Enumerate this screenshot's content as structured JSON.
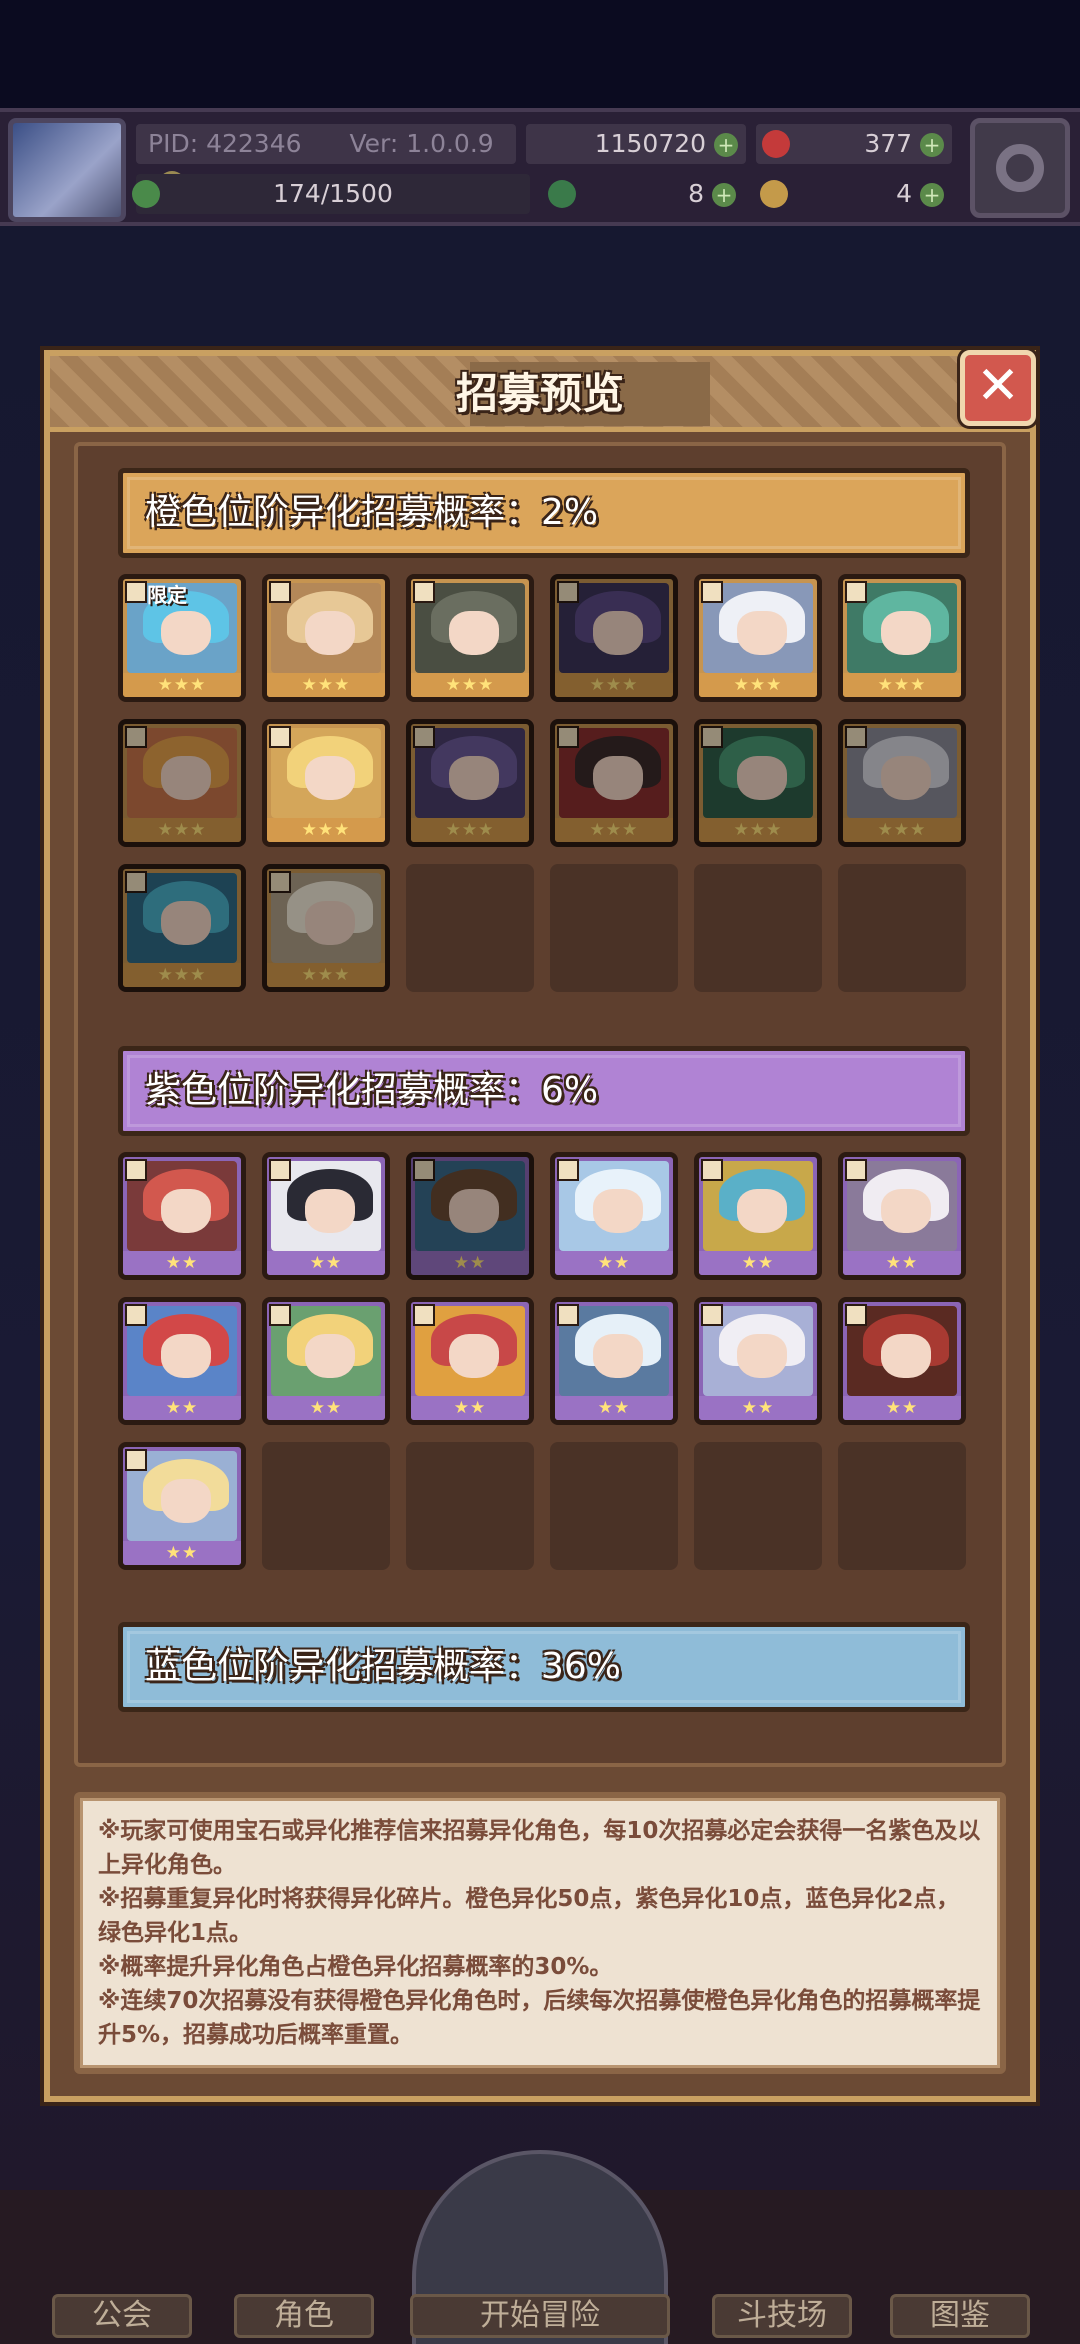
{
  "hud": {
    "pid": "PID: 422346",
    "version": "Ver: 1.0.0.9",
    "gold": "1150720",
    "gems": "377",
    "energy": "174/1500",
    "clover": "8",
    "keys": "4"
  },
  "modal": {
    "title": "招募预览",
    "close_icon": "close-icon"
  },
  "tiers": [
    {
      "label": "橙色位阶异化招募概率：2%",
      "color": "#dba55a",
      "cards": [
        {
          "stars": "★★★",
          "limited": "限定",
          "hair": "#5ec4e6",
          "bg": "#6aa3c8",
          "dim": false
        },
        {
          "stars": "★★★",
          "hair": "#e7c896",
          "bg": "#b48858",
          "dim": false
        },
        {
          "stars": "★★★",
          "hair": "#6a6e60",
          "bg": "#4a4e42",
          "dim": false
        },
        {
          "stars": "★★★",
          "hair": "#5c4b86",
          "bg": "#3c3458",
          "dim": true
        },
        {
          "stars": "★★★",
          "hair": "#eef0f6",
          "bg": "#8898b8",
          "dim": false
        },
        {
          "stars": "★★★",
          "hair": "#5fb6a0",
          "bg": "#3f7a66",
          "dim": false
        },
        {
          "stars": "★★★",
          "hair": "#e4a04a",
          "bg": "#c8744a",
          "dim": true
        },
        {
          "stars": "★★★",
          "hair": "#f2d27a",
          "bg": "#d4a65a",
          "dim": false
        },
        {
          "stars": "★★★",
          "hair": "#6c5a9a",
          "bg": "#4a3e6a",
          "dim": true
        },
        {
          "stars": "★★★",
          "hair": "#3a2a2a",
          "bg": "#8a2e2e",
          "dim": true
        },
        {
          "stars": "★★★",
          "hair": "#4a9a74",
          "bg": "#2e5e48",
          "dim": true
        },
        {
          "stars": "★★★",
          "hair": "#d6d6de",
          "bg": "#8a8a98",
          "dim": true
        },
        {
          "stars": "★★★",
          "hair": "#4ab0c8",
          "bg": "#2e6a86",
          "dim": true
        },
        {
          "stars": "★★★",
          "hair": "#f2ead8",
          "bg": "#b0a088",
          "dim": true
        }
      ]
    },
    {
      "label": "紫色位阶异化招募概率：6%",
      "color": "#b083d4",
      "cards": [
        {
          "stars": "★★",
          "hair": "#d2584e",
          "bg": "#7a3a3a",
          "dim": false
        },
        {
          "stars": "★★",
          "hair": "#2a2a34",
          "bg": "#e8e8ee",
          "dim": false
        },
        {
          "stars": "★★",
          "hair": "#6a4a34",
          "bg": "#3a6a8a",
          "dim": true
        },
        {
          "stars": "★★",
          "hair": "#e8f2fa",
          "bg": "#a8c8e6",
          "dim": false
        },
        {
          "stars": "★★",
          "hair": "#5ab0c8",
          "bg": "#c8a84a",
          "dim": false
        },
        {
          "stars": "★★",
          "hair": "#f0ecf2",
          "bg": "#8a7a9a",
          "dim": false
        },
        {
          "stars": "★★",
          "hair": "#d24848",
          "bg": "#5a84c8",
          "dim": false
        },
        {
          "stars": "★★",
          "hair": "#f2d27a",
          "bg": "#6aa070",
          "dim": false
        },
        {
          "stars": "★★",
          "hair": "#c84848",
          "bg": "#e0a040",
          "dim": false
        },
        {
          "stars": "★★",
          "hair": "#e6f0f8",
          "bg": "#5a7aa0",
          "dim": false
        },
        {
          "stars": "★★",
          "hair": "#f0eef4",
          "bg": "#a8b0d6",
          "dim": false
        },
        {
          "stars": "★★",
          "hair": "#a83a32",
          "bg": "#5a2a22",
          "dim": false
        },
        {
          "stars": "★★",
          "hair": "#f2dc9a",
          "bg": "#9ab0d4",
          "dim": false
        }
      ]
    },
    {
      "label": "蓝色位阶异化招募概率：36%",
      "color": "#8fbcd8",
      "cards": []
    }
  ],
  "info": [
    "※玩家可使用宝石或异化推荐信来招募异化角色，每10次招募必定会获得一名紫色及以上异化角色。",
    "※招募重复异化时将获得异化碎片。橙色异化50点，紫色异化10点，蓝色异化2点，绿色异化1点。",
    "※概率提升异化角色占橙色异化招募概率的30%。",
    "※连续70次招募没有获得橙色异化角色时，后续每次招募使橙色异化角色的招募概率提升5%，招募成功后概率重置。"
  ],
  "nav": {
    "guild": "公会",
    "characters": "角色",
    "start": "开始冒险",
    "arena": "斗技场",
    "codex": "图鉴"
  }
}
